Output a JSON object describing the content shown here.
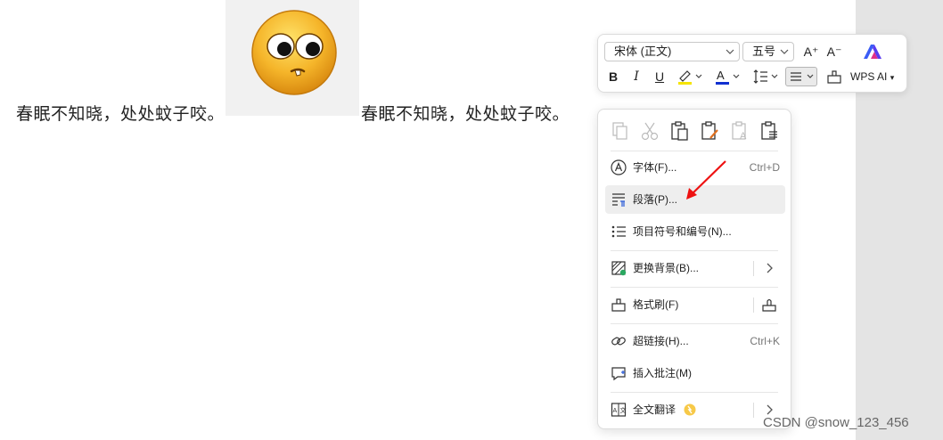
{
  "document": {
    "text_left": "春眠不知晓，处处蚊子咬。",
    "text_right": "春眠不知晓，处处蚊子咬。",
    "image_icon": "smirking-emoji-icon"
  },
  "mini_toolbar": {
    "font_name": "宋体 (正文)",
    "font_size": "五号",
    "grow_font_icon": "A⁺",
    "shrink_font_icon": "A⁻",
    "bold": "B",
    "italic": "I",
    "underline": "U",
    "font_color_letter": "A",
    "highlight_color": "#f5e400",
    "font_color": "#1030d0",
    "wps_ai_label": "WPS AI"
  },
  "context_menu": {
    "clipboard_icons": [
      "copy-icon",
      "cut-icon",
      "paste-icon",
      "paste-keep-format-icon",
      "paste-text-only-icon",
      "paste-special-icon"
    ],
    "items": [
      {
        "label": "字体(F)...",
        "shortcut": "Ctrl+D",
        "icon": "font-icon"
      },
      {
        "label": "段落(P)...",
        "icon": "paragraph-icon"
      },
      {
        "label": "项目符号和编号(N)...",
        "icon": "bullet-list-icon"
      },
      {
        "label": "更换背景(B)...",
        "icon": "background-icon"
      },
      {
        "label": "格式刷(F)",
        "icon": "format-painter-icon"
      },
      {
        "label": "超链接(H)...",
        "shortcut": "Ctrl+K",
        "icon": "hyperlink-icon"
      },
      {
        "label": "插入批注(M)",
        "icon": "comment-icon"
      },
      {
        "label": "全文翻译",
        "icon": "translate-icon"
      }
    ]
  },
  "watermark": "CSDN @snow_123_456"
}
